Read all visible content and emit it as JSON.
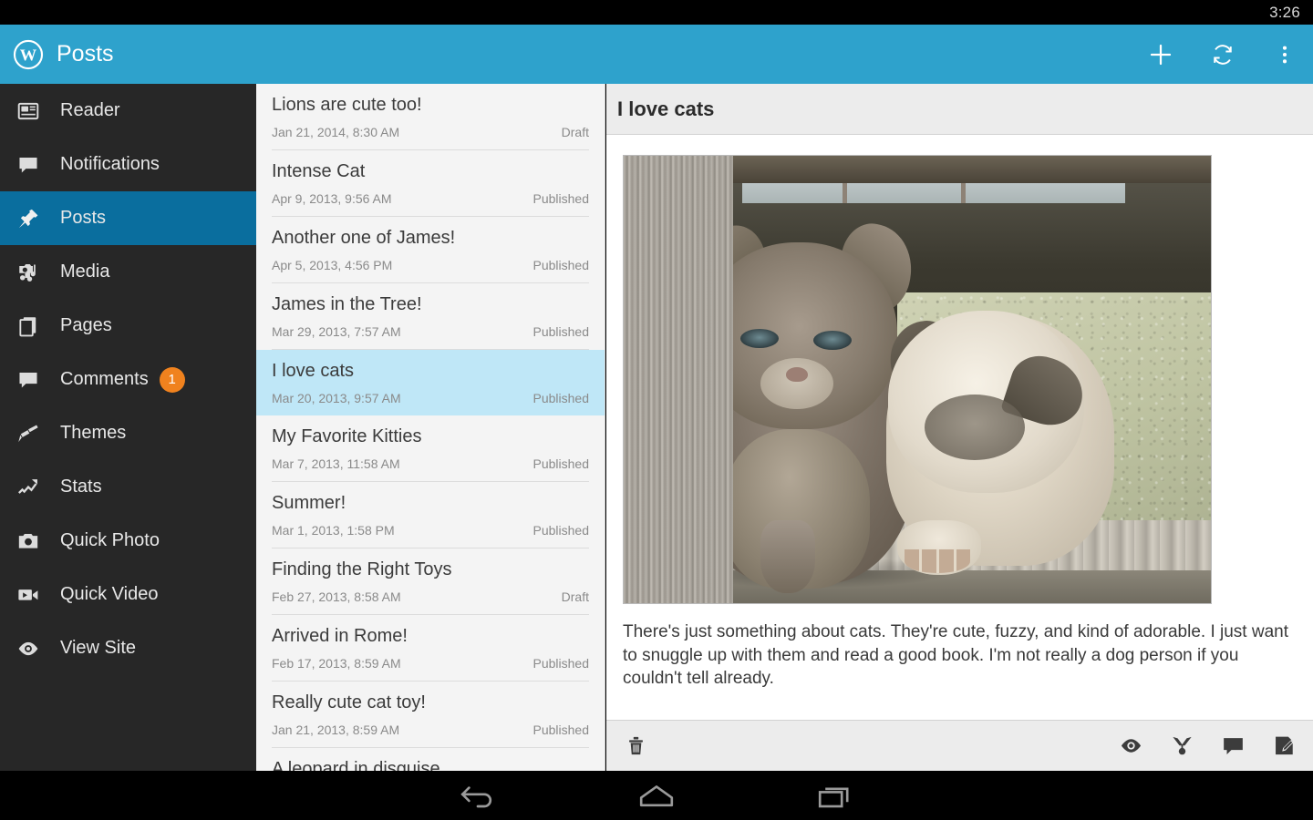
{
  "statusbar": {
    "clock": "3:26"
  },
  "actionbar": {
    "title": "Posts",
    "logo_icon": "wordpress-logo-icon",
    "actions": [
      {
        "name": "add-post-button",
        "icon": "plus-icon",
        "label": "New post"
      },
      {
        "name": "refresh-button",
        "icon": "refresh-icon",
        "label": "Refresh"
      },
      {
        "name": "overflow-menu-button",
        "icon": "more-vertical-icon",
        "label": "More options"
      }
    ]
  },
  "sidebar": {
    "items": [
      {
        "label": "Reader",
        "icon": "reader-icon",
        "active": false,
        "badge": ""
      },
      {
        "label": "Notifications",
        "icon": "notifications-icon",
        "active": false,
        "badge": ""
      },
      {
        "label": "Posts",
        "icon": "pin-icon",
        "active": true,
        "badge": ""
      },
      {
        "label": "Media",
        "icon": "media-icon",
        "active": false,
        "badge": ""
      },
      {
        "label": "Pages",
        "icon": "pages-icon",
        "active": false,
        "badge": ""
      },
      {
        "label": "Comments",
        "icon": "comment-icon",
        "active": false,
        "badge": "1"
      },
      {
        "label": "Themes",
        "icon": "brush-icon",
        "active": false,
        "badge": ""
      },
      {
        "label": "Stats",
        "icon": "stats-icon",
        "active": false,
        "badge": ""
      },
      {
        "label": "Quick Photo",
        "icon": "camera-icon",
        "active": false,
        "badge": ""
      },
      {
        "label": "Quick Video",
        "icon": "video-icon",
        "active": false,
        "badge": ""
      },
      {
        "label": "View Site",
        "icon": "eye-icon",
        "active": false,
        "badge": ""
      }
    ]
  },
  "post_list": {
    "posts": [
      {
        "title": "Lions are cute too!",
        "date": "Jan 21, 2014, 8:30 AM",
        "status": "Draft",
        "selected": false
      },
      {
        "title": "Intense Cat",
        "date": "Apr 9, 2013, 9:56 AM",
        "status": "Published",
        "selected": false
      },
      {
        "title": "Another one of James!",
        "date": "Apr 5, 2013, 4:56 PM",
        "status": "Published",
        "selected": false
      },
      {
        "title": "James in the Tree!",
        "date": "Mar 29, 2013, 7:57 AM",
        "status": "Published",
        "selected": false
      },
      {
        "title": "I love cats",
        "date": "Mar 20, 2013, 9:57 AM",
        "status": "Published",
        "selected": true
      },
      {
        "title": "My Favorite Kitties",
        "date": "Mar 7, 2013, 11:58 AM",
        "status": "Published",
        "selected": false
      },
      {
        "title": "Summer!",
        "date": "Mar 1, 2013, 1:58 PM",
        "status": "Published",
        "selected": false
      },
      {
        "title": "Finding the Right Toys",
        "date": "Feb 27, 2013, 8:58 AM",
        "status": "Draft",
        "selected": false
      },
      {
        "title": "Arrived in Rome!",
        "date": "Feb 17, 2013, 8:59 AM",
        "status": "Published",
        "selected": false
      },
      {
        "title": "Really cute cat toy!",
        "date": "Jan 21, 2013, 8:59 AM",
        "status": "Published",
        "selected": false
      },
      {
        "title": "A leopard in disguise",
        "date": "",
        "status": "",
        "selected": false
      }
    ]
  },
  "detail": {
    "title": "I love cats",
    "image_alt": "Two kittens sitting on a weathered wooden step",
    "body": "There's just something about cats. They're cute, fuzzy, and kind of adorable. I just want to snuggle up with them and read a good book. I'm not really a dog person if you couldn't tell already.",
    "toolbar": {
      "delete": {
        "name": "delete-post-button",
        "icon": "trash-icon",
        "label": "Delete"
      },
      "right": [
        {
          "name": "view-post-button",
          "icon": "eye-icon",
          "label": "View"
        },
        {
          "name": "share-post-button",
          "icon": "share-icon",
          "label": "Share"
        },
        {
          "name": "comments-button",
          "icon": "comment-icon",
          "label": "Comments"
        },
        {
          "name": "edit-post-button",
          "icon": "edit-icon",
          "label": "Edit"
        }
      ]
    }
  },
  "navbar": {
    "buttons": [
      {
        "name": "android-back-button",
        "icon": "back-arrow-icon",
        "label": "Back"
      },
      {
        "name": "android-home-button",
        "icon": "home-icon",
        "label": "Home"
      },
      {
        "name": "android-recents-button",
        "icon": "recents-icon",
        "label": "Recent apps"
      }
    ]
  },
  "colors": {
    "accent": "#2EA2CC",
    "sidebar_bg": "#272727",
    "sidebar_active": "#0A6E9E",
    "badge": "#F0821E",
    "selected_row": "#BFE7F7",
    "list_bg": "#F4F4F4"
  }
}
